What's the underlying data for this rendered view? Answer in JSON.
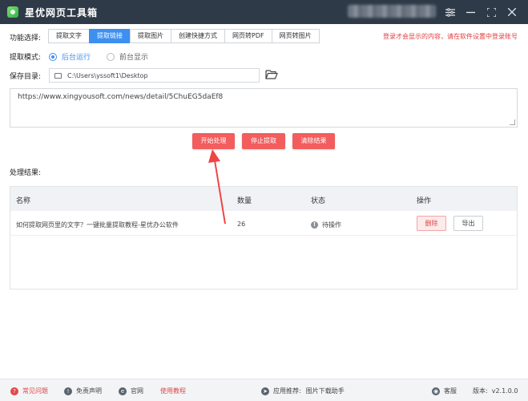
{
  "app": {
    "title": "星优网页工具箱"
  },
  "header": {
    "user_blurred": ""
  },
  "window_controls": {
    "settings": "≡",
    "minimize": "—",
    "maximize": "⛶",
    "close": "✕"
  },
  "function_row": {
    "label": "功能选择:",
    "tabs": [
      {
        "label": "提取文字",
        "active": false
      },
      {
        "label": "提取链接",
        "active": true
      },
      {
        "label": "提取图片",
        "active": false
      },
      {
        "label": "创建快捷方式",
        "active": false
      },
      {
        "label": "网页转PDF",
        "active": false
      },
      {
        "label": "网页转图片",
        "active": false
      }
    ],
    "login_notice": "登录才会显示的内容，请在软件设置中登录账号"
  },
  "mode_row": {
    "label": "提取模式:",
    "options": [
      {
        "label": "后台运行",
        "selected": true
      },
      {
        "label": "前台显示",
        "selected": false
      }
    ]
  },
  "save_row": {
    "label": "保存目录:",
    "path": "C:\\Users\\yssoft1\\Desktop"
  },
  "url_input": {
    "value": "https://www.xingyousoft.com/news/detail/5ChuEG5daEf8"
  },
  "actions": {
    "start": "开始处理",
    "stop": "停止提取",
    "clear": "清除结果"
  },
  "results": {
    "title": "处理结果:",
    "columns": {
      "name": "名称",
      "count": "数量",
      "status": "状态",
      "ops": "操作"
    },
    "rows": [
      {
        "name": "如何提取网页里的文字？一键批量提取教程-星优办公软件",
        "count": "26",
        "status": "待操作",
        "delete": "删除",
        "export": "导出"
      }
    ]
  },
  "footer": {
    "faq": "常见问题",
    "disclaimer": "免责声明",
    "website": "官网",
    "tutorial": "使用教程",
    "recommend_label": "应用推荐:",
    "recommend_app": "图片下载助手",
    "support": "客服",
    "version_label": "版本:",
    "version": "v2.1.0.0"
  },
  "colors": {
    "titlebar": "#2f3a48",
    "accent": "#3d8ff0",
    "action": "#f25d5d",
    "notice": "#e23b3b"
  }
}
